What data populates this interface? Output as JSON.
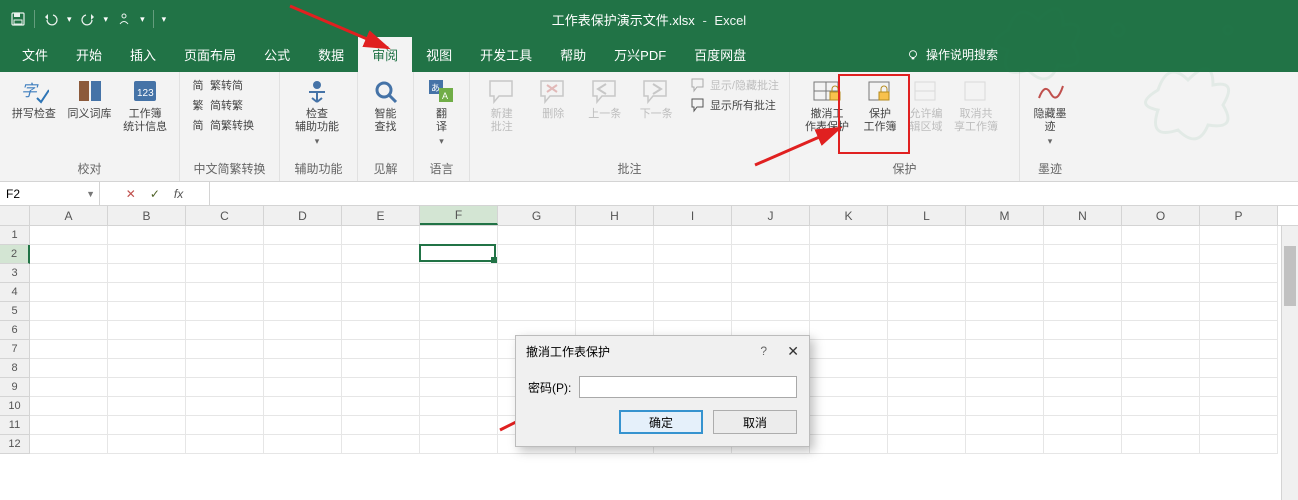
{
  "titlebar": {
    "filename": "工作表保护演示文件.xlsx",
    "app": "Excel"
  },
  "tabs": {
    "file": "文件",
    "home": "开始",
    "insert": "插入",
    "layout": "页面布局",
    "formulas": "公式",
    "data": "数据",
    "review": "审阅",
    "view": "视图",
    "developer": "开发工具",
    "help": "帮助",
    "wxpdf": "万兴PDF",
    "baidu": "百度网盘",
    "tellme": "操作说明搜索"
  },
  "ribbon": {
    "proofing": {
      "spelling": "拼写检查",
      "thesaurus": "同义词库",
      "workbookstats": "工作簿\n统计信息",
      "group": "校对"
    },
    "chinese": {
      "l1": "繁转简",
      "l2": "简转繁",
      "l3": "简繁转换",
      "group": "中文简繁转换"
    },
    "accessibility": {
      "check": "检查\n辅助功能",
      "group": "辅助功能"
    },
    "insights": {
      "smart": "智能\n查找",
      "group": "见解"
    },
    "language": {
      "translate": "翻\n译",
      "group": "语言"
    },
    "comments": {
      "new": "新建\n批注",
      "delete": "删除",
      "prev": "上一条",
      "next": "下一条",
      "show_hide": "显示/隐藏批注",
      "show_all": "显示所有批注",
      "group": "批注"
    },
    "protect": {
      "unprotect": "撤消工\n作表保护",
      "protect_wb_l1": "保护",
      "protect_wb_l2": "工作簿",
      "allow_edit_l1": "允许编",
      "allow_edit_l2": "辑区域",
      "unshare_l1": "取消共",
      "unshare_l2": "享工作簿",
      "group": "保护"
    },
    "ink": {
      "hide": "隐藏墨\n迹",
      "group": "墨迹"
    }
  },
  "formula_bar": {
    "name": "F2",
    "fx": "fx"
  },
  "columns": [
    "A",
    "B",
    "C",
    "D",
    "E",
    "F",
    "G",
    "H",
    "I",
    "J",
    "K",
    "L",
    "M",
    "N",
    "O",
    "P"
  ],
  "rows": [
    "1",
    "2",
    "3",
    "4",
    "5",
    "6",
    "7",
    "8",
    "9",
    "10",
    "11",
    "12"
  ],
  "active": {
    "col_index": 5,
    "row_index": 1
  },
  "dialog": {
    "title": "撤消工作表保护",
    "pwd_label": "密码(P):",
    "ok": "确定",
    "cancel": "取消"
  }
}
